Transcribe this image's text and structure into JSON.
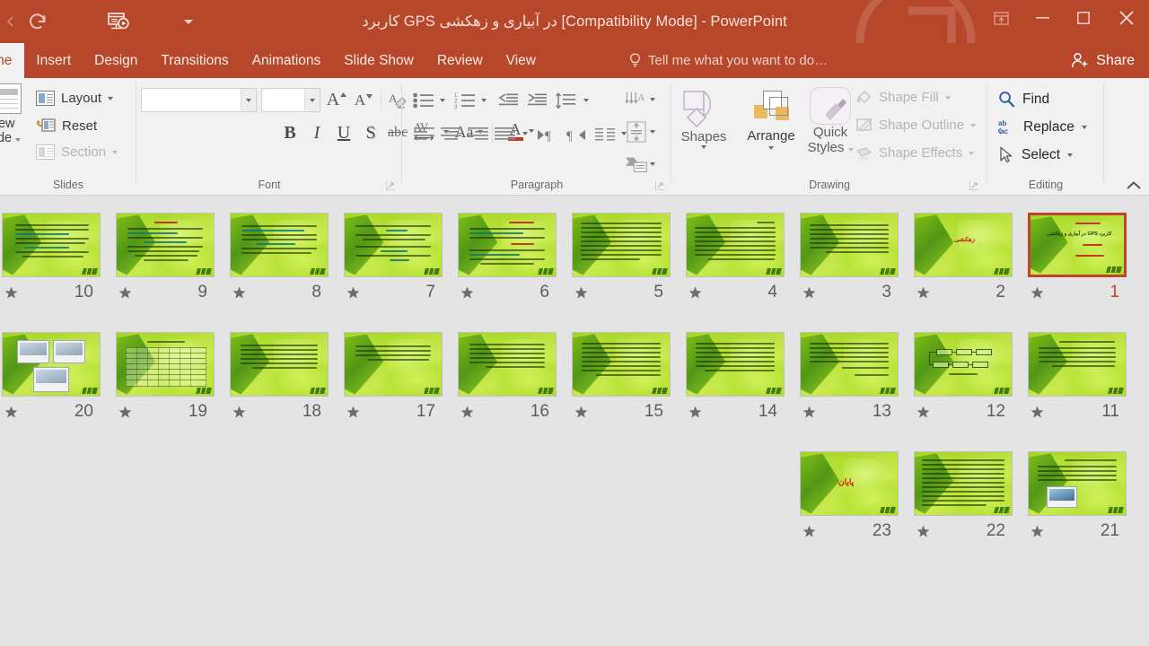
{
  "window": {
    "title": "کاربرد GPS در آبیاری و زهکشی [Compatibility Mode] - PowerPoint",
    "accent_color": "#b7472a",
    "body_background": "#e4e4e4"
  },
  "quick_access": [
    {
      "name": "redo",
      "glyph": "redo-icon"
    },
    {
      "name": "start-from-beginning",
      "glyph": "slideshow-icon"
    },
    {
      "name": "customize-quick-access-toolbar",
      "glyph": "chevron-down-icon"
    }
  ],
  "window_controls": {
    "ribbon_display_options": "ribbon-display-options-icon",
    "minimize": "minimize-icon",
    "restore": "restore-icon",
    "close": "close-icon"
  },
  "tabs": [
    {
      "label": "Home",
      "active": true
    },
    {
      "label": "Insert",
      "active": false
    },
    {
      "label": "Design",
      "active": false
    },
    {
      "label": "Transitions",
      "active": false
    },
    {
      "label": "Animations",
      "active": false
    },
    {
      "label": "Slide Show",
      "active": false
    },
    {
      "label": "Review",
      "active": false
    },
    {
      "label": "View",
      "active": false
    }
  ],
  "tell_me": {
    "placeholder": "Tell me what you want to do…",
    "icon": "lightbulb-icon"
  },
  "share": {
    "label": "Share",
    "icon": "person-add-icon"
  },
  "ribbon": {
    "groups": [
      {
        "label": "Slides",
        "has_launcher": false
      },
      {
        "label": "Font",
        "has_launcher": true
      },
      {
        "label": "Paragraph",
        "has_launcher": true
      },
      {
        "label": "Drawing",
        "has_launcher": true
      },
      {
        "label": "Editing",
        "has_launcher": false
      }
    ],
    "slides": {
      "new_slide_line1": "New",
      "new_slide_line2": "Slide",
      "layout": "Layout",
      "reset": "Reset",
      "section": "Section"
    },
    "font": {
      "font_name_value": "",
      "font_size_value": "",
      "increase_font_size": "A",
      "decrease_font_size": "A",
      "clear_formatting": "clear-formatting-icon",
      "bold": "B",
      "italic": "I",
      "underline": "U",
      "text_shadow": "S",
      "strikethrough": "abc",
      "character_spacing": "AV",
      "change_case": "Aa",
      "font_color": "A"
    },
    "paragraph": {
      "bullets": "bullets-icon",
      "numbering": "numbering-icon",
      "decrease_indent": "decrease-indent-icon",
      "increase_indent": "increase-indent-icon",
      "line_spacing": "line-spacing-icon",
      "align_left": "align-left-icon",
      "center": "align-center-icon",
      "align_right": "align-right-icon",
      "justify": "justify-icon",
      "ltr": "text-direction-ltr-icon",
      "rtl": "text-direction-rtl-icon",
      "columns": "columns-icon",
      "text_direction": "text-direction-icon",
      "align_text": "align-text-icon",
      "convert_to_smartart": "smartart-icon"
    },
    "drawing": {
      "shapes": "Shapes",
      "arrange": "Arrange",
      "quick_styles_line1": "Quick",
      "quick_styles_line2": "Styles",
      "shape_fill": "Shape Fill",
      "shape_outline": "Shape Outline",
      "shape_effects": "Shape Effects"
    },
    "editing": {
      "find": "Find",
      "replace": "Replace",
      "select": "Select",
      "find_icon": "search-icon",
      "replace_icon": "replace-abac-icon",
      "select_icon": "cursor-arrow-icon"
    },
    "collapse": "collapse-ribbon-icon"
  },
  "slide_panel": {
    "selected_slide": 1,
    "rows": [
      {
        "slides": [
          10,
          9,
          8,
          7,
          6,
          5,
          4,
          3,
          2,
          1
        ]
      },
      {
        "slides": [
          20,
          19,
          18,
          17,
          16,
          15,
          14,
          13,
          12,
          11
        ]
      },
      {
        "slides": [
          23,
          22,
          21
        ]
      }
    ],
    "slides": [
      {
        "number": 10,
        "kind": "text",
        "star": true
      },
      {
        "number": 9,
        "kind": "text-title",
        "star": true
      },
      {
        "number": 8,
        "kind": "text",
        "star": true
      },
      {
        "number": 7,
        "kind": "text",
        "star": true
      },
      {
        "number": 6,
        "kind": "text-two-headings",
        "star": true
      },
      {
        "number": 5,
        "kind": "text-dense",
        "star": true
      },
      {
        "number": 4,
        "kind": "text-dense",
        "star": true
      },
      {
        "number": 3,
        "kind": "text-dense",
        "star": true
      },
      {
        "number": 2,
        "kind": "red-title",
        "title": "زهکشی",
        "star": true
      },
      {
        "number": 1,
        "kind": "cover",
        "title": "کاربرد GPS در آبیاری و زهکشی",
        "star": true,
        "selected": true
      },
      {
        "number": 20,
        "kind": "pictures",
        "star": true
      },
      {
        "number": 19,
        "kind": "table",
        "star": true
      },
      {
        "number": 18,
        "kind": "text",
        "star": true
      },
      {
        "number": 17,
        "kind": "text",
        "star": true
      },
      {
        "number": 16,
        "kind": "text",
        "star": true
      },
      {
        "number": 15,
        "kind": "text-dense",
        "star": true
      },
      {
        "number": 14,
        "kind": "text-dense",
        "star": true
      },
      {
        "number": 13,
        "kind": "text",
        "star": true
      },
      {
        "number": 12,
        "kind": "flowchart",
        "star": true
      },
      {
        "number": 11,
        "kind": "text",
        "star": true
      },
      {
        "number": 23,
        "kind": "red-title",
        "title": "پایان",
        "star": true
      },
      {
        "number": 22,
        "kind": "text-dense",
        "star": true
      },
      {
        "number": 21,
        "kind": "text-with-pic",
        "star": true
      }
    ]
  }
}
